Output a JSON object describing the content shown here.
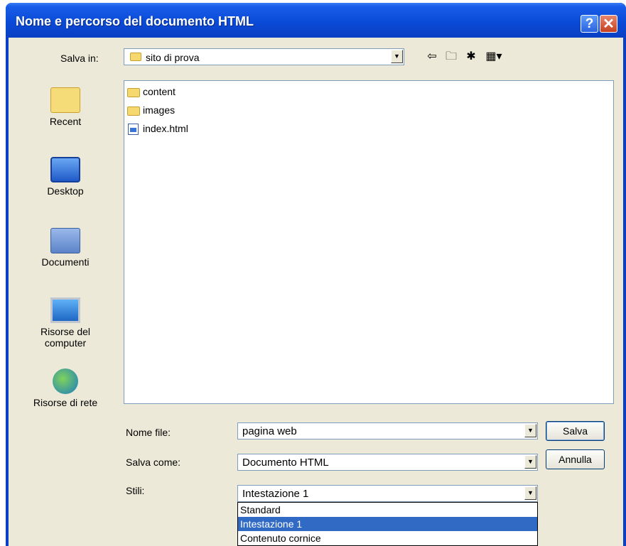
{
  "window": {
    "title": "Nome e percorso del documento HTML"
  },
  "titlebar": {
    "help_label": "?",
    "close_label": "✕"
  },
  "save_in": {
    "label": "Salva in:",
    "value": "sito di prova"
  },
  "toolbar": {
    "back_icon": "back-arrow-icon",
    "up_icon": "up-folder-icon",
    "new_folder_icon": "new-folder-icon",
    "view_icon": "view-menu-icon",
    "back_glyph": "⇦",
    "up_glyph": "🗀",
    "new_folder_glyph": "✱",
    "view_glyph": "▦▾"
  },
  "places": [
    {
      "label": "Recent",
      "icon": "recent-folder-icon"
    },
    {
      "label": "Desktop",
      "icon": "desktop-icon"
    },
    {
      "label": "Documenti",
      "icon": "documents-icon"
    },
    {
      "label": "Risorse del computer",
      "icon": "computer-icon"
    },
    {
      "label": "Risorse di rete",
      "icon": "network-icon"
    }
  ],
  "files": [
    {
      "name": "content",
      "type": "folder"
    },
    {
      "name": "images",
      "type": "folder"
    },
    {
      "name": "index.html",
      "type": "html"
    }
  ],
  "filename": {
    "label": "Nome file:",
    "value": "pagina web"
  },
  "save_as": {
    "label": "Salva come:",
    "value": "Documento HTML"
  },
  "styles": {
    "label": "Stili:",
    "value": "Intestazione 1",
    "options": [
      "Standard",
      "Intestazione 1",
      "Contenuto cornice"
    ],
    "selected_index": 1
  },
  "buttons": {
    "save": "Salva",
    "cancel": "Annulla"
  },
  "colors": {
    "titlebar": "#0a4ad8",
    "dialog_bg": "#ece9d8",
    "selection": "#316ac5"
  }
}
